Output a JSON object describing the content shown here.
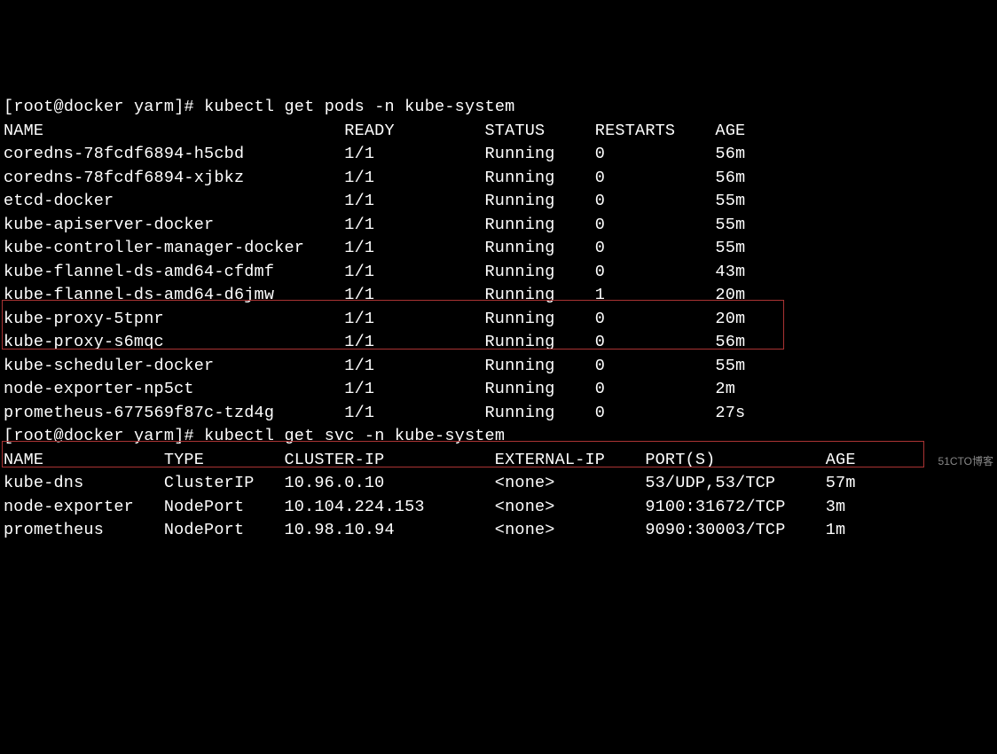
{
  "prompt1": {
    "user": "root",
    "host": "docker",
    "cwd": "yarm",
    "command": "kubectl get pods -n kube-system"
  },
  "pods": {
    "headers": [
      "NAME",
      "READY",
      "STATUS",
      "RESTARTS",
      "AGE"
    ],
    "rows": [
      {
        "name": "coredns-78fcdf6894-h5cbd",
        "ready": "1/1",
        "status": "Running",
        "restarts": "0",
        "age": "56m"
      },
      {
        "name": "coredns-78fcdf6894-xjbkz",
        "ready": "1/1",
        "status": "Running",
        "restarts": "0",
        "age": "56m"
      },
      {
        "name": "etcd-docker",
        "ready": "1/1",
        "status": "Running",
        "restarts": "0",
        "age": "55m"
      },
      {
        "name": "kube-apiserver-docker",
        "ready": "1/1",
        "status": "Running",
        "restarts": "0",
        "age": "55m"
      },
      {
        "name": "kube-controller-manager-docker",
        "ready": "1/1",
        "status": "Running",
        "restarts": "0",
        "age": "55m"
      },
      {
        "name": "kube-flannel-ds-amd64-cfdmf",
        "ready": "1/1",
        "status": "Running",
        "restarts": "0",
        "age": "43m"
      },
      {
        "name": "kube-flannel-ds-amd64-d6jmw",
        "ready": "1/1",
        "status": "Running",
        "restarts": "1",
        "age": "20m"
      },
      {
        "name": "kube-proxy-5tpnr",
        "ready": "1/1",
        "status": "Running",
        "restarts": "0",
        "age": "20m"
      },
      {
        "name": "kube-proxy-s6mqc",
        "ready": "1/1",
        "status": "Running",
        "restarts": "0",
        "age": "56m"
      },
      {
        "name": "kube-scheduler-docker",
        "ready": "1/1",
        "status": "Running",
        "restarts": "0",
        "age": "55m"
      },
      {
        "name": "node-exporter-np5ct",
        "ready": "1/1",
        "status": "Running",
        "restarts": "0",
        "age": "2m"
      },
      {
        "name": "prometheus-677569f87c-tzd4g",
        "ready": "1/1",
        "status": "Running",
        "restarts": "0",
        "age": "27s"
      }
    ]
  },
  "prompt2": {
    "user": "root",
    "host": "docker",
    "cwd": "yarm",
    "command": "kubectl get svc -n kube-system"
  },
  "svc": {
    "headers": [
      "NAME",
      "TYPE",
      "CLUSTER-IP",
      "EXTERNAL-IP",
      "PORT(S)",
      "AGE"
    ],
    "rows": [
      {
        "name": "kube-dns",
        "type": "ClusterIP",
        "clusterip": "10.96.0.10",
        "externalip": "<none>",
        "ports": "53/UDP,53/TCP",
        "age": "57m"
      },
      {
        "name": "node-exporter",
        "type": "NodePort",
        "clusterip": "10.104.224.153",
        "externalip": "<none>",
        "ports": "9100:31672/TCP",
        "age": "3m"
      },
      {
        "name": "prometheus",
        "type": "NodePort",
        "clusterip": "10.98.10.94",
        "externalip": "<none>",
        "ports": "9090:30003/TCP",
        "age": "1m"
      }
    ]
  },
  "watermark": "51CTO博客"
}
